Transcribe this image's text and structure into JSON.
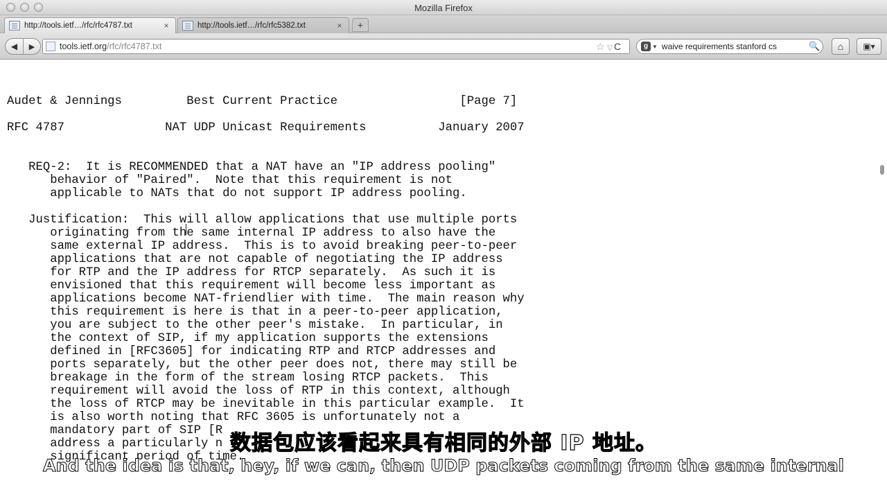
{
  "window": {
    "title": "Mozilla Firefox"
  },
  "tabs": [
    {
      "label": "http://tools.ietf…/rfc/rfc4787.txt",
      "close": "×"
    },
    {
      "label": "http://tools.ietf…/rfc/rfc5382.txt",
      "close": "×"
    }
  ],
  "new_tab_label": "+",
  "navbar": {
    "back": "◀",
    "forward": "▶",
    "url_host": "tools.ietf.org",
    "url_path": "/rfc/rfc4787.txt",
    "bookmark_star": "☆",
    "dropdown": "▽",
    "reload": "C",
    "search_engine": "g",
    "search_engine_arrow": "▼",
    "search_query": "waive requirements stanford cs",
    "search_glyph": "🔍",
    "home": "⌂",
    "addons": "▣▾"
  },
  "document": {
    "lines": [
      "Audet & Jennings         Best Current Practice                 [Page 7]",
      "",
      "RFC 4787              NAT UDP Unicast Requirements          January 2007",
      "",
      "",
      "   REQ-2:  It is RECOMMENDED that a NAT have an \"IP address pooling\"",
      "      behavior of \"Paired\".  Note that this requirement is not",
      "      applicable to NATs that do not support IP address pooling.",
      "",
      "   Justification:  This will allow applications that use multiple ports",
      "      originating from the same internal IP address to also have the",
      "      same external IP address.  This is to avoid breaking peer-to-peer",
      "      applications that are not capable of negotiating the IP address",
      "      for RTP and the IP address for RTCP separately.  As such it is",
      "      envisioned that this requirement will become less important as",
      "      applications become NAT-friendlier with time.  The main reason why",
      "      this requirement is here is that in a peer-to-peer application,",
      "      you are subject to the other peer's mistake.  In particular, in",
      "      the context of SIP, if my application supports the extensions",
      "      defined in [RFC3605] for indicating RTP and RTCP addresses and",
      "      ports separately, but the other peer does not, there may still be",
      "      breakage in the form of the stream losing RTCP packets.  This",
      "      requirement will avoid the loss of RTP in this context, although",
      "      the loss of RTCP may be inevitable in this particular example.  It",
      "      is also worth noting that RFC 3605 is unfortunately not a",
      "      mandatory part of SIP [R",
      "      address a particularly n",
      "      significant period of time."
    ]
  },
  "subtitles": {
    "zh": "数据包应该看起来具有相同的外部 IP 地址。",
    "en": "And the idea is that, hey, if we can, then UDP packets coming from the same internal"
  }
}
